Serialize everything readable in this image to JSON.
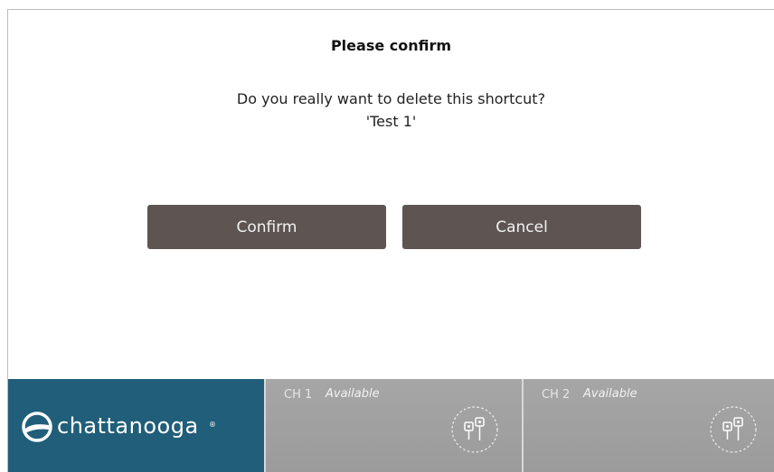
{
  "dialog": {
    "title": "Please confirm",
    "message_line1": "Do you really want to delete this shortcut?",
    "message_line2": "'Test 1'",
    "confirm_label": "Confirm",
    "cancel_label": "Cancel",
    "button_color": "#5e5553"
  },
  "footer": {
    "brand": {
      "name": "chattanooga",
      "registered_mark": "®",
      "color": "#205e79",
      "icon": "chattanooga-logo-icon"
    },
    "channels": [
      {
        "label": "CH 1",
        "status": "Available",
        "icon": "electrode-icon"
      },
      {
        "label": "CH 2",
        "status": "Available",
        "icon": "electrode-icon"
      }
    ]
  }
}
